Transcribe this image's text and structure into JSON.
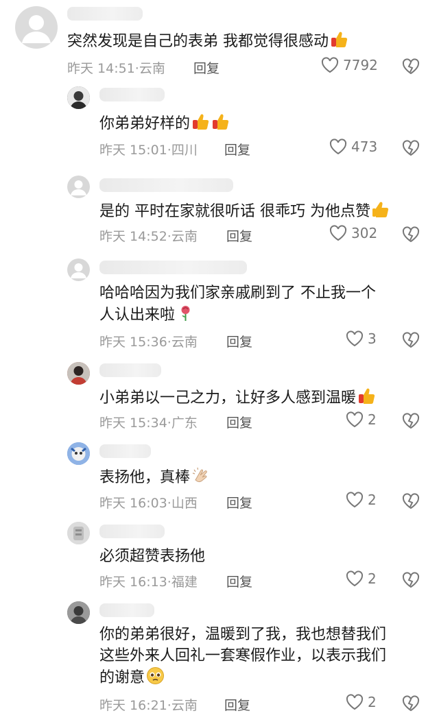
{
  "comments": [
    {
      "text": [
        "突然发现是自己的表弟 我都觉得很感动"
      ],
      "emoji": [
        "thumbs-up-icon"
      ],
      "time": "昨天 14:51",
      "location": "云南",
      "reply": "回复",
      "likes": "7792"
    },
    {
      "text": [
        "你弟弟好样的"
      ],
      "emoji": [
        "thumbs-up-icon",
        "thumbs-up-icon"
      ],
      "time": "昨天 15:01",
      "location": "四川",
      "reply": "回复",
      "likes": "473"
    },
    {
      "text": [
        "是的 平时在家就很听话 很乖巧 为他点赞"
      ],
      "emoji": [
        "thumbs-up-icon"
      ],
      "time": "昨天 14:52",
      "location": "云南",
      "reply": "回复",
      "likes": "302"
    },
    {
      "text": [
        "哈哈哈因为我们家亲戚刷到了 不止我一个",
        "人认出来啦"
      ],
      "emoji": [
        "rose-icon"
      ],
      "time": "昨天 15:36",
      "location": "云南",
      "reply": "回复",
      "likes": "3"
    },
    {
      "text": [
        "小弟弟以一己之力，让好多人感到温暖"
      ],
      "emoji": [
        "thumbs-up-icon"
      ],
      "time": "昨天 15:34",
      "location": "广东",
      "reply": "回复",
      "likes": "2"
    },
    {
      "text": [
        "表扬他，真棒"
      ],
      "emoji": [
        "clapping-hands-icon"
      ],
      "time": "昨天 16:03",
      "location": "山西",
      "reply": "回复",
      "likes": "2"
    },
    {
      "text": [
        "必须超赞表扬他"
      ],
      "emoji": [],
      "time": "昨天 16:13",
      "location": "福建",
      "reply": "回复",
      "likes": "2"
    },
    {
      "text": [
        "你的弟弟很好，温暖到了我，我也想替我们",
        "这些外来人回礼一套寒假作业，以表示我们",
        "的谢意"
      ],
      "emoji": [
        "pleading-face-icon"
      ],
      "time": "昨天 16:21",
      "location": "云南",
      "reply": "回复",
      "likes": "2"
    }
  ],
  "separator": "·",
  "colors": {
    "text": "#1a1a1a",
    "meta": "#9a9a9a",
    "icon": "#777777",
    "thumb": "#f5b21a",
    "cuff": "#e23b2e"
  }
}
